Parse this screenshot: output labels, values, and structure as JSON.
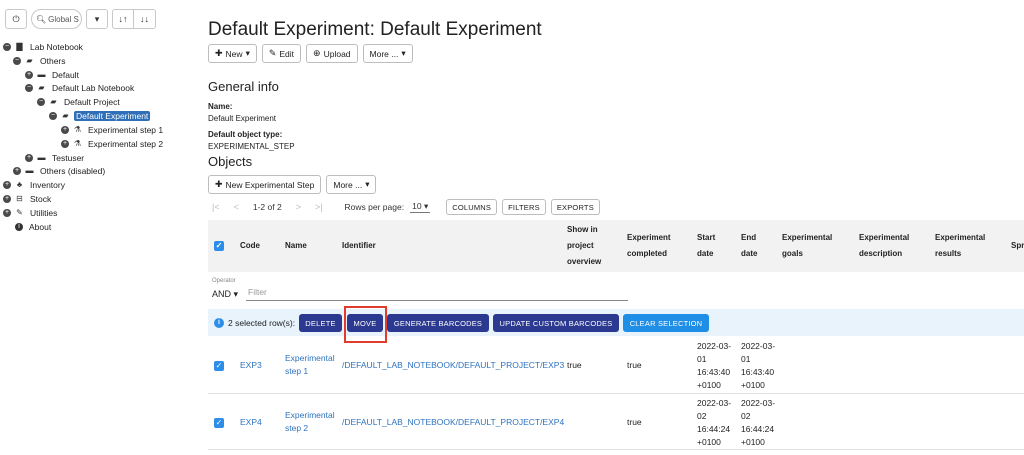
{
  "sidebar": {
    "search_placeholder": "Global S",
    "tree": [
      {
        "label": "Lab Notebook",
        "icon": "book-icon",
        "toggle": "−"
      },
      {
        "label": "Others",
        "icon": "folder-open-icon",
        "toggle": "−"
      },
      {
        "label": "Default",
        "icon": "folder-icon",
        "toggle": "+"
      },
      {
        "label": "Default Lab Notebook",
        "icon": "folder-open-icon",
        "toggle": "−"
      },
      {
        "label": "Default Project",
        "icon": "folder-open-icon",
        "toggle": "−"
      },
      {
        "label": "Default Experiment",
        "icon": "folder-open-icon",
        "toggle": "−"
      },
      {
        "label": "Experimental step 1",
        "icon": "flask-icon",
        "toggle": "+"
      },
      {
        "label": "Experimental step 2",
        "icon": "flask-icon",
        "toggle": "+"
      },
      {
        "label": "Testuser",
        "icon": "folder-icon",
        "toggle": "+"
      },
      {
        "label": "Others (disabled)",
        "icon": "folder-icon",
        "toggle": "+"
      },
      {
        "label": "Inventory",
        "icon": "cubes-icon",
        "toggle": "+"
      },
      {
        "label": "Stock",
        "icon": "cart-icon",
        "toggle": "+"
      },
      {
        "label": "Utilities",
        "icon": "wrench-icon",
        "toggle": "+"
      },
      {
        "label": "About",
        "icon": "info-icon",
        "toggle": ""
      }
    ]
  },
  "main": {
    "title": "Default Experiment: Default Experiment",
    "buttons": {
      "new": "New",
      "edit": "Edit",
      "upload": "Upload",
      "more": "More ..."
    },
    "general_info": {
      "heading": "General info",
      "name_label": "Name:",
      "name_value": "Default Experiment",
      "type_label": "Default object type:",
      "type_value": "EXPERIMENTAL_STEP"
    },
    "objects": {
      "heading": "Objects",
      "new_step_button": "New Experimental Step",
      "more_button": "More ..."
    },
    "pager": {
      "range": "1-2 of 2",
      "rows_per_page_label": "Rows per page:",
      "rows_per_page_value": "10",
      "columns_button": "COLUMNS",
      "filters_button": "FILTERS",
      "exports_button": "EXPORTS"
    },
    "table": {
      "columns": {
        "code": "Code",
        "name": "Name",
        "identifier": "Identifier",
        "show_in_overview": "Show in project overview",
        "completed": "Experiment completed",
        "start": "Start date",
        "end": "End date",
        "goals": "Experimental goals",
        "description": "Experimental description",
        "results": "Experimental results",
        "spreadsheet": "Spr"
      },
      "filter": {
        "operator_label": "Operator",
        "operator_value": "AND",
        "placeholder": "Filter"
      },
      "selection": {
        "text": "2 selected row(s):",
        "delete": "DELETE",
        "move": "MOVE",
        "generate_barcodes": "GENERATE BARCODES",
        "update_barcodes": "UPDATE CUSTOM BARCODES",
        "clear": "CLEAR SELECTION"
      },
      "rows": [
        {
          "code": "EXP3",
          "name": "Experimental step 1",
          "identifier": "/DEFAULT_LAB_NOTEBOOK/DEFAULT_PROJECT/EXP3",
          "show_in_overview": "true",
          "completed": "true",
          "start": "2022-03-01 16:43:40 +0100",
          "end": "2022-03-01 16:43:40 +0100"
        },
        {
          "code": "EXP4",
          "name": "Experimental step 2",
          "identifier": "/DEFAULT_LAB_NOTEBOOK/DEFAULT_PROJECT/EXP4",
          "show_in_overview": "",
          "completed": "true",
          "start": "2022-03-02 16:44:24 +0100",
          "end": "2022-03-02 16:44:24 +0100"
        }
      ]
    }
  }
}
